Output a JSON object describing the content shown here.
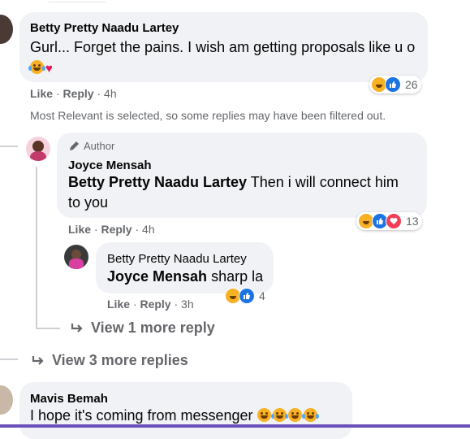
{
  "comment1": {
    "author": "Betty Pretty Naadu Lartey",
    "text": "Gurl... Forget the pains. I wish am getting proposals like u o",
    "like": "Like",
    "reply": "Reply",
    "time": "4h",
    "reaction_count": "26"
  },
  "filter_notice": "Most Relevant is selected, so some replies may have been filtered out.",
  "reply1": {
    "badge": "Author",
    "author": "Joyce Mensah",
    "mention": "Betty Pretty Naadu Lartey",
    "text": " Then i will connect him to you",
    "like": "Like",
    "reply": "Reply",
    "time": "4h",
    "reaction_count": "13"
  },
  "reply2": {
    "author": "Betty Pretty Naadu Lartey",
    "mention": "Joyce Mensah",
    "text": " sharp la",
    "like": "Like",
    "reply": "Reply",
    "time": "3h",
    "reaction_count": "4"
  },
  "view_more_reply": "View 1 more reply",
  "view_more_replies": "View 3 more replies",
  "comment2": {
    "author": "Mavis Bemah",
    "text": "I hope it's coming from messenger"
  },
  "colors": {
    "bubble": "#f0f2f5",
    "meta": "#65676b",
    "like_blue": "#1b74e4",
    "haha_yellow": "#f7b125",
    "love_red": "#f33e58"
  }
}
